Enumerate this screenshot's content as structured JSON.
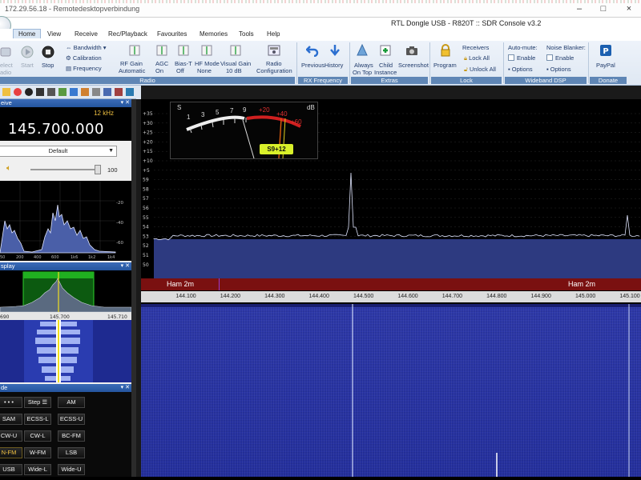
{
  "rdp": {
    "title": "172.29.56.18 - Remotedesktopverbindung",
    "min_glyph": "–",
    "max_glyph": "□",
    "close_glyph": "×"
  },
  "app": {
    "title": "RTL Dongle USB - R820T :: SDR Console v3.2"
  },
  "ribbon_tabs": [
    "Home",
    "View",
    "Receive",
    "Rec/Playback",
    "Favourites",
    "Memories",
    "Tools",
    "Help"
  ],
  "ribbon": {
    "radio_group": {
      "label": "Radio",
      "select": "elect",
      "select2": "adio",
      "start": "Start",
      "stop": "Stop",
      "bandwidth": "Bandwidth",
      "calibration": "Calibration",
      "frequency": "Frequency",
      "rf_gain": "RF Gain",
      "rf_gain_val": "Automatic",
      "agc": "AGC",
      "agc_val": "On",
      "bias_t": "Bias-T",
      "bias_t_val": "Off",
      "hf_mode": "HF Mode",
      "hf_mode_val": "None",
      "visual_gain": "Visual Gain",
      "visual_gain_val": "10 dB",
      "radio": "Radio",
      "configuration": "Configuration"
    },
    "rx_group": {
      "label": "RX Frequency",
      "previous": "Previous",
      "history": "History"
    },
    "extras_group": {
      "label": "Extras",
      "always": "Always",
      "on_top": "On Top",
      "child": "Child",
      "instance": "Instance",
      "screenshot": "Screenshot"
    },
    "lock_group": {
      "label": "Lock",
      "program": "Program",
      "receivers": "Receivers",
      "lock_all": "Lock All",
      "unlock_all": "Unlock All"
    },
    "dsp_group": {
      "label": "Wideband DSP",
      "auto_mute": "Auto-mute:",
      "enable1": "Enable",
      "options1": "Options",
      "noise_blanker": "Noise Blanker:",
      "enable2": "Enable",
      "options2": "Options"
    },
    "donate_group": {
      "label": "Donate",
      "paypal": "PayPal"
    }
  },
  "left": {
    "receive_head": "eive",
    "freq_step": "12 kHz",
    "frequency": "145.700.000",
    "mode_select": "Default",
    "volume": "100",
    "spectrum_x_labels": [
      "50",
      "200",
      "400",
      "600",
      "1k6",
      "1k2",
      "1k4"
    ],
    "spectrum_y_labels": [
      "-20",
      "-40",
      "-60"
    ],
    "display_head": "splay",
    "display_freqs": [
      "690",
      "145.700",
      "145.710"
    ],
    "mode_head": "de",
    "mode_buttons": [
      [
        "• • •",
        "Step ☰",
        "AM"
      ],
      [
        "SAM",
        "ECSS-L",
        "ECSS-U"
      ],
      [
        "CW-U",
        "CW-L",
        "BC-FM"
      ],
      [
        "N-FM",
        "W-FM",
        "LSB"
      ],
      [
        "USB",
        "Wide-L",
        "Wide-U"
      ]
    ]
  },
  "main": {
    "y_labels": [
      "+35",
      "+30",
      "+25",
      "+20",
      "+15",
      "+10",
      "+5",
      "59",
      "58",
      "57",
      "56",
      "55",
      "54",
      "53",
      "52",
      "51",
      "50"
    ],
    "meter": {
      "s_label": "S",
      "db_label": "dB",
      "s_marks": [
        "1",
        "3",
        "5",
        "7",
        "9"
      ],
      "db_marks": [
        "+20",
        "+40",
        "+60"
      ],
      "reading": "S9+12"
    },
    "band_labels": [
      "Ham 2m",
      "Ham 2m"
    ],
    "freq_axis": [
      "144.100",
      "144.200",
      "144.300",
      "144.400",
      "144.500",
      "144.600",
      "144.700",
      "144.800",
      "144.900",
      "145.000",
      "145.100"
    ]
  },
  "colors": {
    "ribbon_group": "#5f86b5",
    "spectrum_line": "#e0e6ff",
    "spectrum_fill": "#303f8a",
    "band_bar": "#7a1010",
    "waterfall": "#2a35a8",
    "freq_text": "#ffffff",
    "meter_badge": "#d9f02a"
  }
}
